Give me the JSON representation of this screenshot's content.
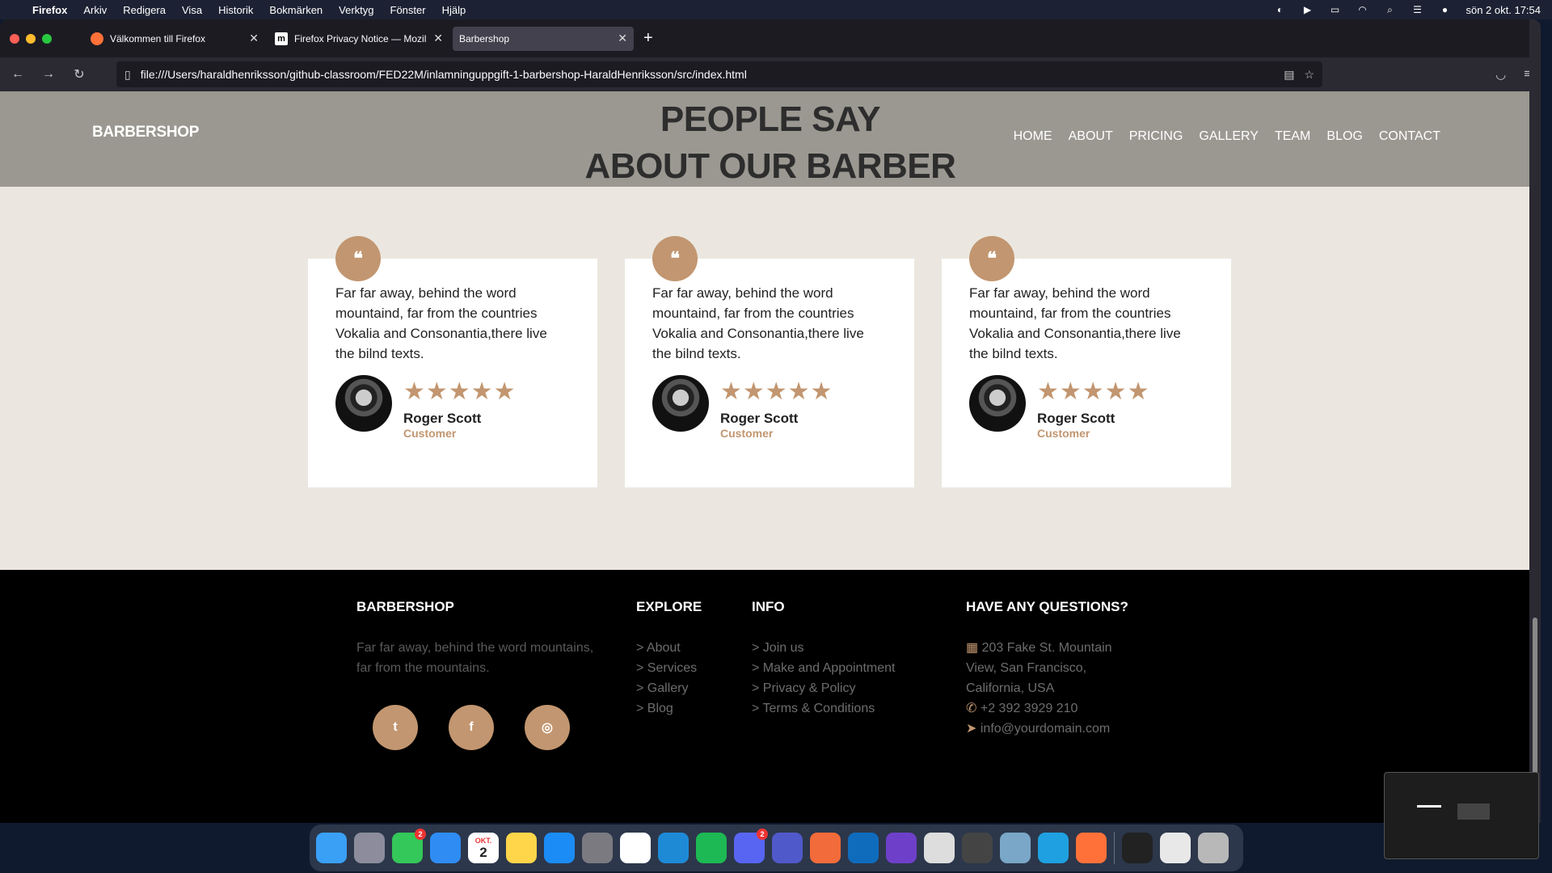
{
  "menubar": {
    "app": "Firefox",
    "items": [
      "Arkiv",
      "Redigera",
      "Visa",
      "Historik",
      "Bokmärken",
      "Verktyg",
      "Fönster",
      "Hjälp"
    ],
    "datetime": "sön 2 okt. 17:54"
  },
  "tabs": [
    {
      "label": "Välkommen till Firefox",
      "icon": "firefox-icon"
    },
    {
      "label": "Firefox Privacy Notice — Mozilla",
      "icon": "mozilla-icon"
    },
    {
      "label": "Barbershop",
      "icon": "none"
    }
  ],
  "url": "file:///Users/haraldhenriksson/github-classroom/FED22M/inlamninguppgift-1-barbershop-HaraldHenriksson/src/index.html",
  "site": {
    "brand": "BARBERSHOP",
    "heading_line1": "PEOPLE SAY",
    "heading_line2": "ABOUT OUR BARBER",
    "nav": [
      "HOME",
      "ABOUT",
      "PRICING",
      "GALLERY",
      "TEAM",
      "BLOG",
      "CONTACT"
    ]
  },
  "testimonials": [
    {
      "text": "Far far away, behind the word mountaind, far from the countries Vokalia and Consonantia,there live the bilnd texts.",
      "stars": "★★★★★",
      "name": "Roger Scott",
      "role": "Customer"
    },
    {
      "text": "Far far away, behind the word mountaind, far from the countries Vokalia and Consonantia,there live the bilnd texts.",
      "stars": "★★★★★",
      "name": "Roger Scott",
      "role": "Customer"
    },
    {
      "text": "Far far away, behind the word mountaind, far from the countries Vokalia and Consonantia,there live the bilnd texts.",
      "stars": "★★★★★",
      "name": "Roger Scott",
      "role": "Customer"
    }
  ],
  "footer": {
    "brand": "BARBERSHOP",
    "about": "Far far away, behind the word mountains, far from the mountains.",
    "explore_title": "EXPLORE",
    "explore": [
      "> About",
      "> Services",
      "> Gallery",
      "> Blog"
    ],
    "info_title": "INFO",
    "info": [
      "> Join us",
      "> Make and Appointment",
      "> Privacy & Policy",
      "> Terms & Conditions"
    ],
    "questions_title": "HAVE ANY QUESTIONS?",
    "address": "203 Fake St. Mountain View, San Francisco, California, USA",
    "phone": "+2 392 3929 210",
    "email": "info@yourdomain.com"
  },
  "dock": {
    "calendar_month": "OKT.",
    "calendar_day": "2",
    "messages_badge": "2",
    "discord_badge": "2"
  },
  "colors": {
    "accent": "#c29670",
    "header_bg": "#9a9891",
    "page_bg": "#ebe7e0"
  }
}
